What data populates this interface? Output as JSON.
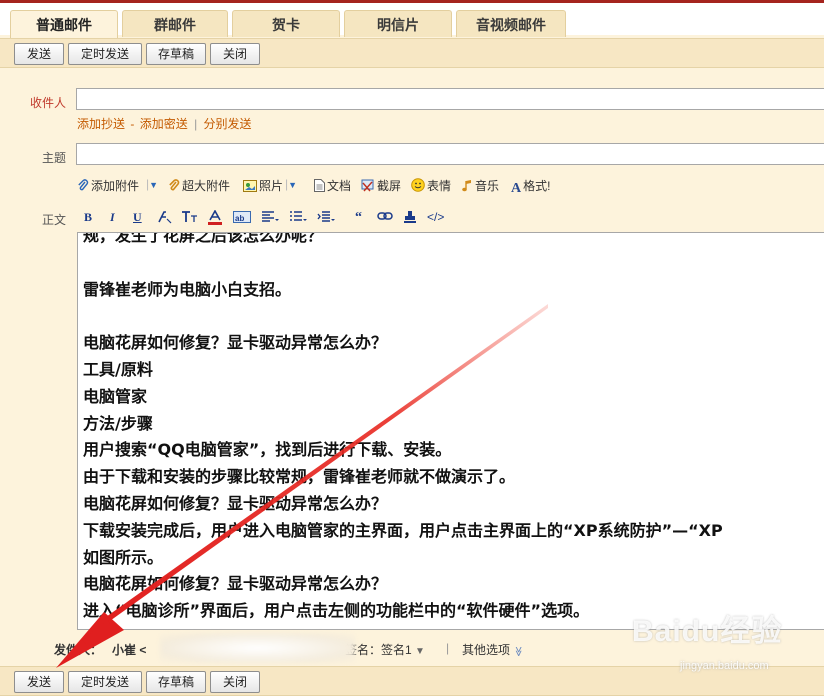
{
  "tabs": [
    {
      "label": "普通邮件",
      "active": true
    },
    {
      "label": "群邮件",
      "active": false
    },
    {
      "label": "贺卡",
      "active": false
    },
    {
      "label": "明信片",
      "active": false
    },
    {
      "label": "音视频邮件",
      "active": false
    }
  ],
  "toolbar": {
    "send": "发送",
    "timed_send": "定时发送",
    "save_draft": "存草稿",
    "close": "关闭"
  },
  "recipient": {
    "label": "收件人",
    "add_cc": "添加抄送",
    "dash": "-",
    "add_bcc": "添加密送",
    "separator": "|",
    "separate_send": "分别发送"
  },
  "subject": {
    "label": "主题"
  },
  "attachments": {
    "add_attachment": "添加附件",
    "large_attachment": "超大附件",
    "photo": "照片",
    "document": "文档",
    "screenshot": "截屏",
    "emoticon": "表情",
    "music": "音乐",
    "format": "格式!"
  },
  "body": {
    "label": "正文",
    "format_buttons": [
      "B",
      "I",
      "U",
      "</>"
    ],
    "lines": [
      "规，发生了花屏之后该怎么办呢？",
      "",
      "雷锋崔老师为电脑小白支招。",
      "",
      "电脑花屏如何修复？显卡驱动异常怎么办？",
      "工具/原料",
      "电脑管家",
      "方法/步骤",
      "用户搜索“QQ电脑管家”，找到后进行下载、安装。",
      "由于下载和安装的步骤比较常规，雷锋崔老师就不做演示了。",
      "电脑花屏如何修复？显卡驱动异常怎么办？",
      "下载安装完成后，用户进入电脑管家的主界面，用户点击主界面上的“XP系统防护”—“XP",
      "如图所示。",
      "电脑花屏如何修复？显卡驱动异常怎么办？",
      "进入“电脑诊所”界面后，用户点击左侧的功能栏中的“软件硬件”选项。"
    ]
  },
  "footer": {
    "sender_label": "发件人：",
    "sender_name": "小崔 <",
    "signature": "签名：签名1",
    "signature_arrow": "▼",
    "separator": "|",
    "other_options": "其他选项",
    "other_arrow": "≫"
  },
  "watermark": {
    "text": "Baidu经验",
    "url": "jingyan.baidu.com"
  },
  "colors": {
    "accent_red": "#a5241e",
    "background": "#fdf3dc",
    "link_orange": "#c45a00",
    "arrow_red": "#e01f1f"
  }
}
